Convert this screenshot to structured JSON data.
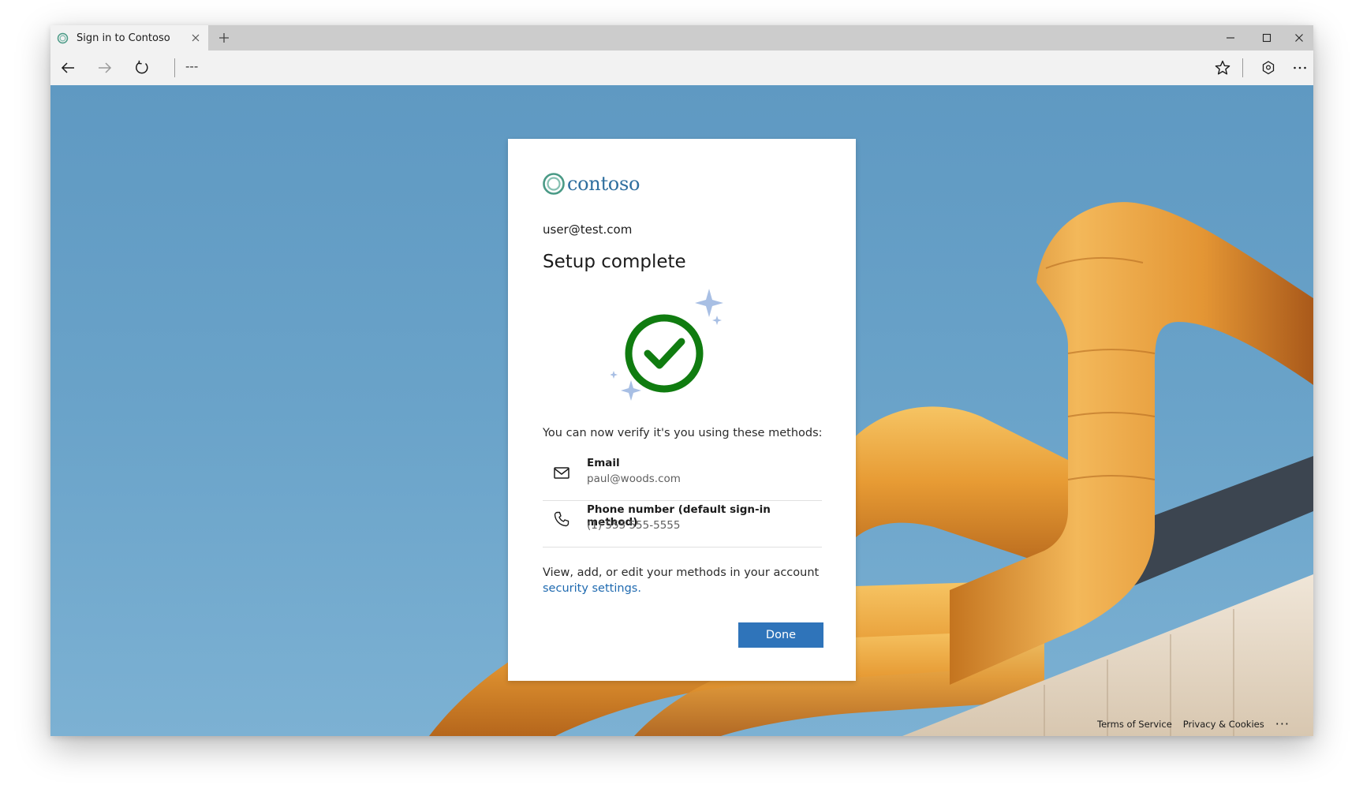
{
  "browser": {
    "tab_title": "Sign in to Contoso",
    "address": "---",
    "new_tab_icon": "plus-icon",
    "tab_close_icon": "close-icon",
    "back_icon": "arrow-left-icon",
    "forward_icon": "arrow-right-icon",
    "refresh_icon": "refresh-icon",
    "favorite_icon": "star-icon",
    "share_icon": "share-icon",
    "more_icon": "ellipsis-icon"
  },
  "card": {
    "brand": "contoso",
    "user": "user@test.com",
    "title": "Setup complete",
    "description": "You can now verify it's you using these methods:",
    "methods": [
      {
        "name": "Email",
        "value": "paul@woods.com",
        "icon": "mail-icon"
      },
      {
        "name": "Phone number (default sign-in method)",
        "value": "(1) 555 555-5555",
        "icon": "phone-icon"
      }
    ],
    "edit_text": "View, add, or edit your methods in your account",
    "edit_link": "security settings.",
    "done_label": "Done"
  },
  "footer": {
    "terms": "Terms of Service",
    "privacy": "Privacy & Cookies",
    "more": "···"
  },
  "colors": {
    "brand": "#2f6f9f",
    "primary_button": "#2f74ba",
    "link": "#1f6ab0",
    "success": "#107c10",
    "sparkle": "#a8bfe4"
  }
}
